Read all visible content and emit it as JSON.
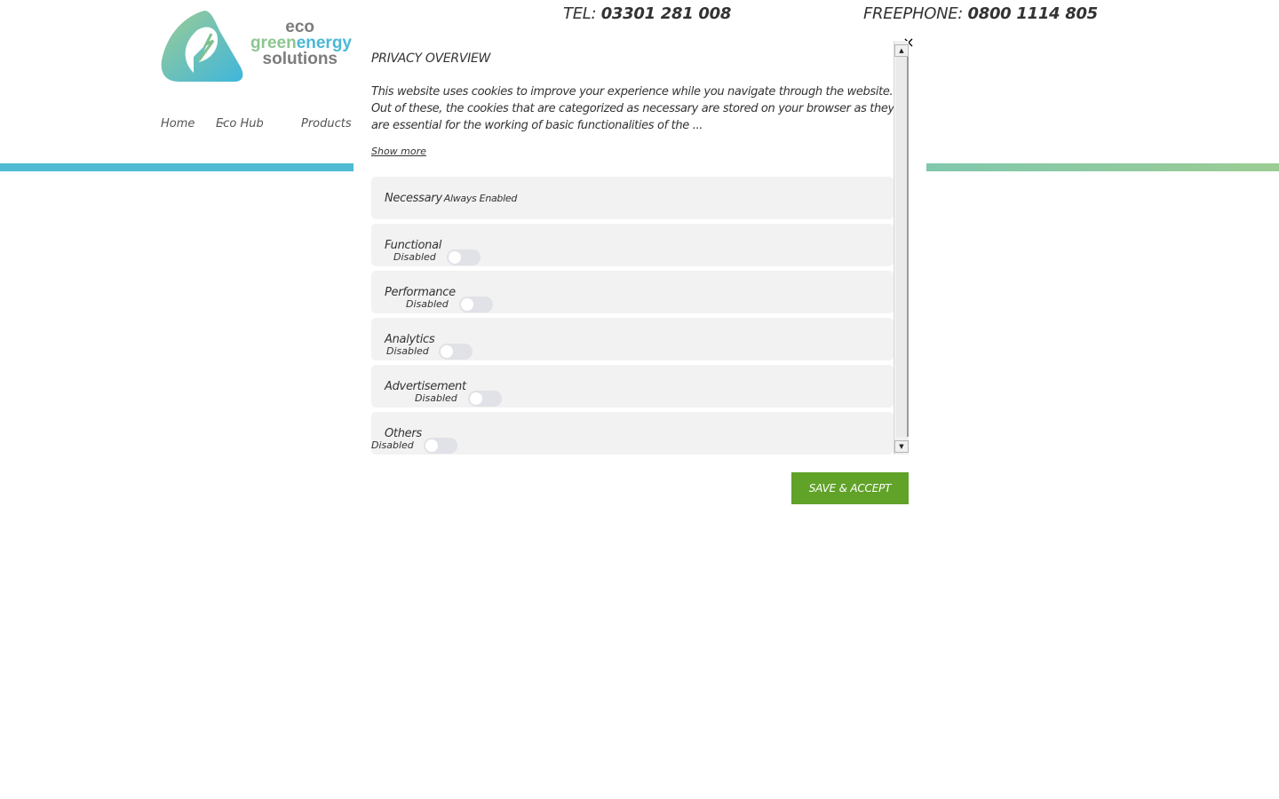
{
  "header": {
    "logo": {
      "line1": "eco",
      "line2a": "green",
      "line2b": "energy",
      "line3": "solutions"
    },
    "tel_label": "TEL:",
    "tel_number": "03301 281 008",
    "freephone_label": "FREEPHONE:",
    "freephone_number": "0800 1114 805"
  },
  "nav": {
    "items": [
      "Home",
      "Eco Hub",
      "Products"
    ]
  },
  "modal": {
    "title": "PRIVACY OVERVIEW",
    "description": "This website uses cookies to improve your experience while you navigate through the website. Out of these, the cookies that are categorized as necessary are stored on your browser as they are essential for the working of basic functionalities of the ...",
    "show_more": "Show more",
    "categories": [
      {
        "name": "Necessary",
        "status": "Always Enabled"
      },
      {
        "name": "Functional",
        "status": "Disabled",
        "enabled": false
      },
      {
        "name": "Performance",
        "status": "Disabled",
        "enabled": false
      },
      {
        "name": "Analytics",
        "status": "Disabled",
        "enabled": false
      },
      {
        "name": "Advertisement",
        "status": "Disabled",
        "enabled": false
      },
      {
        "name": "Others",
        "status": "Disabled",
        "enabled": false
      }
    ],
    "close_icon": "×",
    "save_button": "SAVE & ACCEPT"
  },
  "colors": {
    "brand_blue": "#4fbad3",
    "brand_green": "#9ccc94",
    "button_green": "#61a229"
  }
}
